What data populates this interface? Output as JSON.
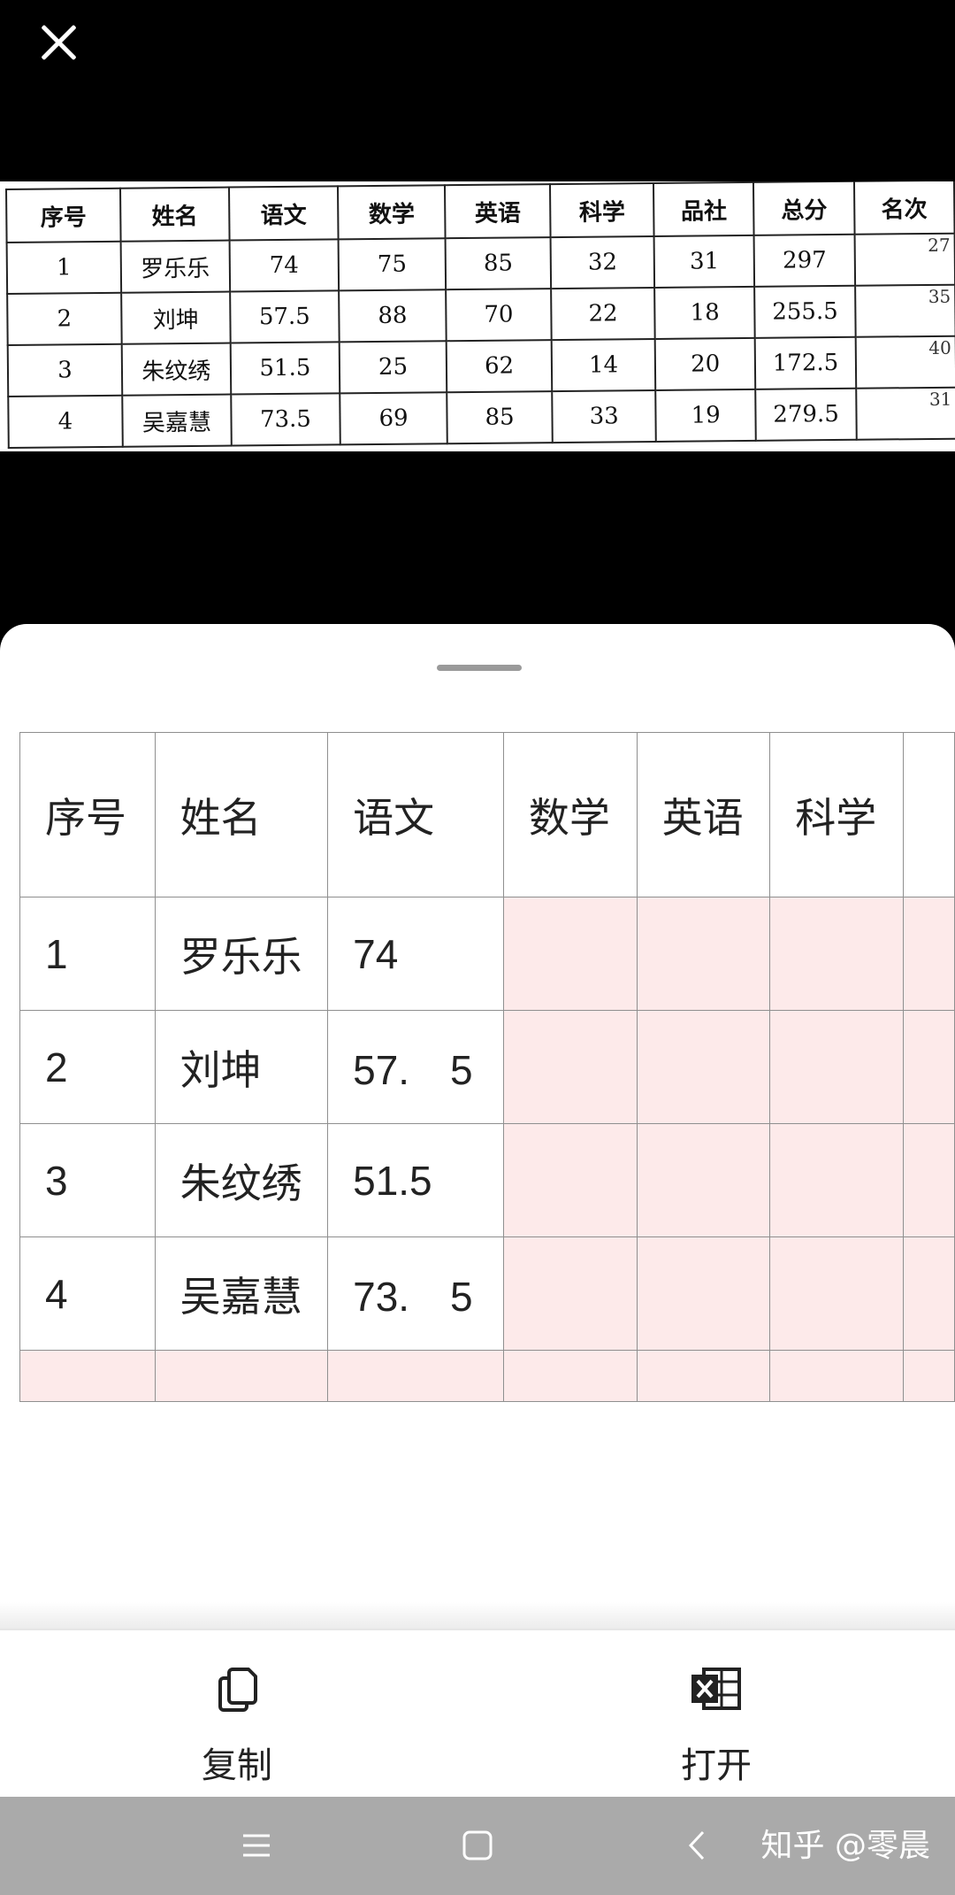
{
  "photo": {
    "rows": [
      [
        "序号",
        "姓名",
        "语文",
        "数学",
        "英语",
        "科学",
        "品社",
        "总分",
        "名次"
      ],
      [
        "1",
        "罗乐乐",
        "74",
        "75",
        "85",
        "32",
        "31",
        "297",
        "27"
      ],
      [
        "2",
        "刘坤",
        "57.5",
        "88",
        "70",
        "22",
        "18",
        "255.5",
        "35"
      ],
      [
        "3",
        "朱纹绣",
        "51.5",
        "25",
        "62",
        "14",
        "20",
        "172.5",
        "40"
      ],
      [
        "4",
        "吴嘉慧",
        "73.5",
        "69",
        "85",
        "33",
        "19",
        "279.5",
        "31"
      ]
    ]
  },
  "table": {
    "headers": [
      "序号",
      "姓名",
      "语文",
      "数学",
      "英语",
      "科学"
    ],
    "rows": [
      [
        "1",
        "罗乐乐",
        "74"
      ],
      [
        "2",
        "刘坤",
        "57.　5"
      ],
      [
        "3",
        "朱纹绣",
        "51.5"
      ],
      [
        "4",
        "吴嘉慧",
        "73.　5"
      ]
    ]
  },
  "actions": {
    "copy_label": "复制",
    "open_label": "打开"
  },
  "watermark": "知乎 @零晨",
  "colors": {
    "empty_cell": "#fdeaea",
    "navbar": "#aaaaaa"
  }
}
